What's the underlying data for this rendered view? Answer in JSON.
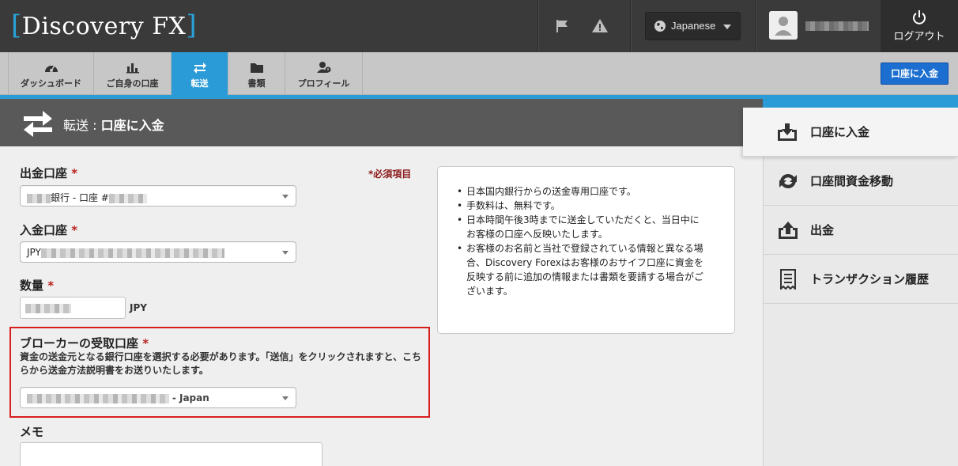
{
  "header": {
    "logo": "Discovery FX",
    "logo_bracket_left": "[",
    "logo_bracket_right": "]",
    "language": "Japanese",
    "logout_label": "ログアウト"
  },
  "tabs": [
    {
      "label": "ダッシュボード",
      "icon": "dashboard-icon"
    },
    {
      "label": "ご自身の口座",
      "icon": "bar-chart-icon"
    },
    {
      "label": "転送",
      "icon": "transfer-icon",
      "active": true
    },
    {
      "label": "書類",
      "icon": "folder-icon"
    },
    {
      "label": "プロフィール",
      "icon": "profile-icon"
    }
  ],
  "deposit_button": "口座に入金",
  "page_heading": {
    "prefix": "転送 : ",
    "title": "口座に入金"
  },
  "form": {
    "required_note": "*必須項目",
    "from_account_label": "出金口座",
    "from_account_value": "銀行 - 口座 #",
    "to_account_label": "入金口座",
    "to_account_value": "JPY",
    "amount_label": "数量",
    "amount_unit": "JPY",
    "broker_label": "ブローカーの受取口座",
    "broker_help": "資金の送金元となる銀行口座を選択する必要があります。「送信」をクリックされますと、こちらから送金方法説明書をお送りいたします。",
    "broker_value": "- Japan",
    "memo_label": "メモ",
    "asterisk": "*"
  },
  "info_items": [
    "日本国内銀行からの送金専用口座です。",
    "手数料は、無料です。",
    "日本時間午後3時までに送金していただくと、当日中にお客様の口座へ反映いたします。",
    "お客様のお名前と当社で登録されている情報と異なる場合、Discovery Forexはお客様のおサイフ口座に資金を反映する前に追加の情報または書類を要請する場合がございます。"
  ],
  "side_menu": [
    {
      "label": "口座に入金",
      "icon": "deposit-icon",
      "active": true
    },
    {
      "label": "口座間資金移動",
      "icon": "internal-transfer-icon"
    },
    {
      "label": "出金",
      "icon": "withdraw-icon"
    },
    {
      "label": "トランザクション履歴",
      "icon": "history-icon"
    }
  ],
  "colors": {
    "accent": "#2a9bd6",
    "button": "#1c6fd0",
    "highlight": "#d71e1e",
    "required": "#b22222"
  }
}
